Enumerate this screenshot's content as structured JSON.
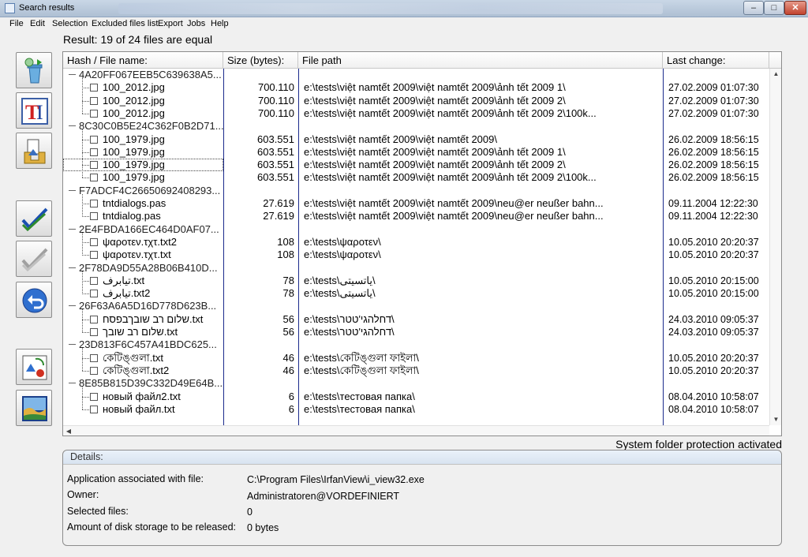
{
  "window": {
    "title": "Search results"
  },
  "menu": [
    "File",
    "Edit",
    "Selection",
    "Excluded files list",
    "Export",
    "Jobs",
    "Help"
  ],
  "result_label": "Result: 19 of 24 files are equal",
  "toolbar": [
    {
      "icon": "recycle-bin-icon"
    },
    {
      "icon": "rename-icon"
    },
    {
      "icon": "move-files-icon"
    },
    {
      "icon": "check-all-icon"
    },
    {
      "icon": "uncheck-all-icon"
    },
    {
      "icon": "undo-icon"
    },
    {
      "icon": "shapes-icon"
    },
    {
      "icon": "image-preview-icon"
    }
  ],
  "columns": {
    "name": "Hash / File name:",
    "size": "Size (bytes):",
    "path": "File path",
    "date": "Last change:"
  },
  "groups": [
    {
      "hash": "4A20FF067EEB5C639638A5...",
      "files": [
        {
          "name": "100_2012.jpg",
          "size": "700.110",
          "path": "e:\\tests\\việt namtết 2009\\việt namtết 2009\\ảnh tết 2009 1\\",
          "date": "27.02.2009 01:07:30"
        },
        {
          "name": "100_2012.jpg",
          "size": "700.110",
          "path": "e:\\tests\\việt namtết 2009\\việt namtết 2009\\ảnh tết 2009 2\\",
          "date": "27.02.2009 01:07:30"
        },
        {
          "name": "100_2012.jpg",
          "size": "700.110",
          "path": "e:\\tests\\việt namtết 2009\\việt namtết 2009\\ảnh tết 2009 2\\100k...",
          "date": "27.02.2009 01:07:30"
        }
      ]
    },
    {
      "hash": "8C30C0B5E24C362F0B2D71...",
      "files": [
        {
          "name": "100_1979.jpg",
          "size": "603.551",
          "path": "e:\\tests\\việt namtết 2009\\việt namtết 2009\\",
          "date": "26.02.2009 18:56:15"
        },
        {
          "name": "100_1979.jpg",
          "size": "603.551",
          "path": "e:\\tests\\việt namtết 2009\\việt namtết 2009\\ảnh tết 2009 1\\",
          "date": "26.02.2009 18:56:15"
        },
        {
          "name": "100_1979.jpg",
          "size": "603.551",
          "path": "e:\\tests\\việt namtết 2009\\việt namtết 2009\\ảnh tết 2009 2\\",
          "date": "26.02.2009 18:56:15"
        },
        {
          "name": "100_1979.jpg",
          "size": "603.551",
          "path": "e:\\tests\\việt namtết 2009\\việt namtết 2009\\ảnh tết 2009 2\\100k...",
          "date": "26.02.2009 18:56:15"
        }
      ]
    },
    {
      "hash": "F7ADCF4C26650692408293...",
      "files": [
        {
          "name": "tntdialogs.pas",
          "size": "27.619",
          "path": "e:\\tests\\việt namtết 2009\\việt namtết 2009\\neu@er neußer bahn...",
          "date": "09.11.2004 12:22:30"
        },
        {
          "name": "tntdialog.pas",
          "size": "27.619",
          "path": "e:\\tests\\việt namtết 2009\\việt namtết 2009\\neu@er neußer bahn...",
          "date": "09.11.2004 12:22:30"
        }
      ]
    },
    {
      "hash": "2E4FBDA166EC464D0AF07...",
      "files": [
        {
          "name": "ψαροτεν.τχτ.txt2",
          "size": "108",
          "path": "e:\\tests\\ψαροτεν\\",
          "date": "10.05.2010 20:20:37"
        },
        {
          "name": "ψαροτεν.τχτ.txt",
          "size": "108",
          "path": "e:\\tests\\ψαροτεν\\",
          "date": "10.05.2010 20:20:37"
        }
      ]
    },
    {
      "hash": "2F78DA9D55A28B06B410D...",
      "files": [
        {
          "name": "تیابرف.txt",
          "size": "78",
          "path": "e:\\tests\\یاتسیتی\\",
          "date": "10.05.2010 20:15:00"
        },
        {
          "name": "تیابرف.txt2",
          "size": "78",
          "path": "e:\\tests\\یاتسیتی\\",
          "date": "10.05.2010 20:15:00"
        }
      ]
    },
    {
      "hash": "26F63A6A5D16D778D623B...",
      "files": [
        {
          "name": "שלום רב שובךבפסח.txt",
          "size": "56",
          "path": "e:\\tests\\דחלהגי'טטר\\",
          "date": "24.03.2010 09:05:37"
        },
        {
          "name": "שלום רב שובך.txt",
          "size": "56",
          "path": "e:\\tests\\דחלהגי'טטר\\",
          "date": "24.03.2010 09:05:37"
        }
      ]
    },
    {
      "hash": "23D813F6C457A41BDC625...",
      "files": [
        {
          "name": "কেটিঙ্গুলা.txt",
          "size": "46",
          "path": "e:\\tests\\কেটিঙ্গুলা ফাইলা\\",
          "date": "10.05.2010 20:20:37"
        },
        {
          "name": "কেটিঙ্গুলা.txt2",
          "size": "46",
          "path": "e:\\tests\\কেটিঙ্গুলা ফাইলা\\",
          "date": "10.05.2010 20:20:37"
        }
      ]
    },
    {
      "hash": "8E85B815D39C332D49E64B...",
      "files": [
        {
          "name": "новый файл2.txt",
          "size": "6",
          "path": "e:\\tests\\тестовая папка\\",
          "date": "08.04.2010 10:58:07"
        },
        {
          "name": "новый файл.txt",
          "size": "6",
          "path": "e:\\tests\\тестовая папка\\",
          "date": "08.04.2010 10:58:07"
        }
      ]
    }
  ],
  "system_protection": "System folder protection activated",
  "details": {
    "title": "Details:",
    "rows": [
      {
        "label": "Application associated with file:",
        "value": "C:\\Program Files\\IrfanView\\i_view32.exe"
      },
      {
        "label": "Owner:",
        "value": "Administratoren@VORDEFINIERT"
      },
      {
        "label": "Selected files:",
        "value": "0"
      },
      {
        "label": "Amount of disk storage to be released:",
        "value": "0 bytes"
      }
    ]
  }
}
